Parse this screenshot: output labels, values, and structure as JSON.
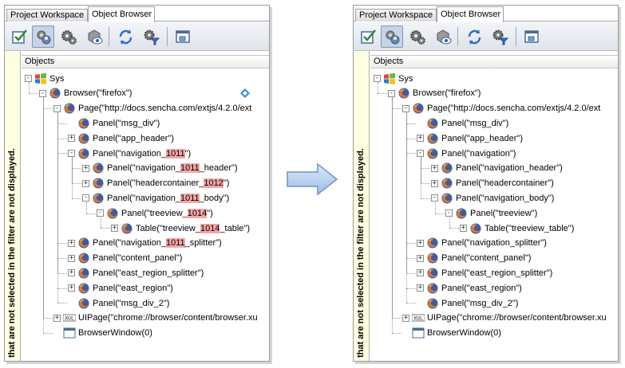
{
  "tabs": [
    "Project Workspace",
    "Object Browser"
  ],
  "objects_header": "Objects",
  "side_note": "that are not selected in the filter are not displayed.",
  "before": [
    {
      "level": 0,
      "exp": "-",
      "icon": "windows",
      "segs": [
        [
          "Sys",
          0
        ]
      ]
    },
    {
      "level": 1,
      "exp": "-",
      "icon": "firefox",
      "segs": [
        [
          "Browser(\"firefox\")",
          0
        ]
      ]
    },
    {
      "level": 2,
      "exp": "-",
      "icon": "firefox",
      "segs": [
        [
          "Page(\"http://docs.sencha.com/extjs/4.2.0/ext",
          0
        ]
      ]
    },
    {
      "level": 3,
      "exp": "",
      "icon": "firefox",
      "segs": [
        [
          "Panel(\"msg_div\")",
          0
        ]
      ]
    },
    {
      "level": 3,
      "exp": "+",
      "icon": "firefox",
      "segs": [
        [
          "Panel(\"app_header\")",
          0
        ]
      ]
    },
    {
      "level": 3,
      "exp": "-",
      "icon": "firefox",
      "segs": [
        [
          "Panel(\"navigation_",
          0
        ],
        [
          "1011",
          1
        ],
        [
          "\")",
          0
        ]
      ]
    },
    {
      "level": 4,
      "exp": "+",
      "icon": "firefox",
      "segs": [
        [
          "Panel(\"navigation_",
          0
        ],
        [
          "1011",
          1
        ],
        [
          "_header\")",
          0
        ]
      ]
    },
    {
      "level": 4,
      "exp": "+",
      "icon": "firefox",
      "segs": [
        [
          "Panel(\"headercontainer_",
          0
        ],
        [
          "1012",
          1
        ],
        [
          "\")",
          0
        ]
      ]
    },
    {
      "level": 4,
      "exp": "-",
      "icon": "firefox",
      "segs": [
        [
          "Panel(\"navigation_",
          0
        ],
        [
          "1011",
          1
        ],
        [
          "_body\")",
          0
        ]
      ]
    },
    {
      "level": 5,
      "exp": "-",
      "icon": "firefox",
      "segs": [
        [
          "Panel(\"treeview_",
          0
        ],
        [
          "1014",
          1
        ],
        [
          "\")",
          0
        ]
      ]
    },
    {
      "level": 6,
      "exp": "+",
      "icon": "firefox",
      "segs": [
        [
          "Table(\"treeview_",
          0
        ],
        [
          "1014",
          1
        ],
        [
          "_table\")",
          0
        ]
      ]
    },
    {
      "level": 3,
      "exp": "+",
      "icon": "firefox",
      "segs": [
        [
          "Panel(\"navigation_",
          0
        ],
        [
          "1011",
          1
        ],
        [
          "_splitter\")",
          0
        ]
      ]
    },
    {
      "level": 3,
      "exp": "+",
      "icon": "firefox",
      "segs": [
        [
          "Panel(\"content_panel\")",
          0
        ]
      ]
    },
    {
      "level": 3,
      "exp": "+",
      "icon": "firefox",
      "segs": [
        [
          "Panel(\"east_region_splitter\")",
          0
        ]
      ]
    },
    {
      "level": 3,
      "exp": "+",
      "icon": "firefox",
      "segs": [
        [
          "Panel(\"east_region\")",
          0
        ]
      ]
    },
    {
      "level": 3,
      "exp": "",
      "icon": "firefox",
      "segs": [
        [
          "Panel(\"msg_div_2\")",
          0
        ]
      ]
    },
    {
      "level": 2,
      "exp": "+",
      "icon": "xul",
      "segs": [
        [
          "UIPage(\"chrome://browser/content/browser.xu",
          0
        ]
      ]
    },
    {
      "level": 2,
      "exp": "",
      "icon": "window",
      "segs": [
        [
          "BrowserWindow(0)",
          0
        ]
      ]
    }
  ],
  "after": [
    {
      "level": 0,
      "exp": "-",
      "icon": "windows",
      "segs": [
        [
          "Sys",
          0
        ]
      ]
    },
    {
      "level": 1,
      "exp": "-",
      "icon": "firefox",
      "segs": [
        [
          "Browser(\"firefox\")",
          0
        ]
      ]
    },
    {
      "level": 2,
      "exp": "-",
      "icon": "firefox",
      "segs": [
        [
          "Page(\"http://docs.sencha.com/extjs/4.2.0/ext",
          0
        ]
      ]
    },
    {
      "level": 3,
      "exp": "",
      "icon": "firefox",
      "segs": [
        [
          "Panel(\"msg_div\")",
          0
        ]
      ]
    },
    {
      "level": 3,
      "exp": "+",
      "icon": "firefox",
      "segs": [
        [
          "Panel(\"app_header\")",
          0
        ]
      ]
    },
    {
      "level": 3,
      "exp": "-",
      "icon": "firefox",
      "segs": [
        [
          "Panel(\"navigation\")",
          0
        ]
      ]
    },
    {
      "level": 4,
      "exp": "+",
      "icon": "firefox",
      "segs": [
        [
          "Panel(\"navigation_header\")",
          0
        ]
      ]
    },
    {
      "level": 4,
      "exp": "+",
      "icon": "firefox",
      "segs": [
        [
          "Panel(\"headercontainer\")",
          0
        ]
      ]
    },
    {
      "level": 4,
      "exp": "-",
      "icon": "firefox",
      "segs": [
        [
          "Panel(\"navigation_body\")",
          0
        ]
      ]
    },
    {
      "level": 5,
      "exp": "-",
      "icon": "firefox",
      "segs": [
        [
          "Panel(\"treeview\")",
          0
        ]
      ]
    },
    {
      "level": 6,
      "exp": "+",
      "icon": "firefox",
      "segs": [
        [
          "Table(\"treeview_table\")",
          0
        ]
      ]
    },
    {
      "level": 3,
      "exp": "+",
      "icon": "firefox",
      "segs": [
        [
          "Panel(\"navigation_splitter\")",
          0
        ]
      ]
    },
    {
      "level": 3,
      "exp": "+",
      "icon": "firefox",
      "segs": [
        [
          "Panel(\"content_panel\")",
          0
        ]
      ]
    },
    {
      "level": 3,
      "exp": "+",
      "icon": "firefox",
      "segs": [
        [
          "Panel(\"east_region_splitter\")",
          0
        ]
      ]
    },
    {
      "level": 3,
      "exp": "+",
      "icon": "firefox",
      "segs": [
        [
          "Panel(\"east_region\")",
          0
        ]
      ]
    },
    {
      "level": 3,
      "exp": "",
      "icon": "firefox",
      "segs": [
        [
          "Panel(\"msg_div_2\")",
          0
        ]
      ]
    },
    {
      "level": 2,
      "exp": "+",
      "icon": "xul",
      "segs": [
        [
          "UIPage(\"chrome://browser/content/browser.xu",
          0
        ]
      ]
    },
    {
      "level": 2,
      "exp": "",
      "icon": "window",
      "segs": [
        [
          "BrowserWindow(0)",
          0
        ]
      ]
    }
  ],
  "colors": {
    "highlight": "#f4a6a6",
    "accent": "#3a6fc4"
  },
  "toolbar_icons": [
    "checkbox-icon",
    "object-properties-icon",
    "gears-icon",
    "object-spy-icon",
    "refresh-icon",
    "filter-gear-icon",
    "window-mapping-icon"
  ]
}
